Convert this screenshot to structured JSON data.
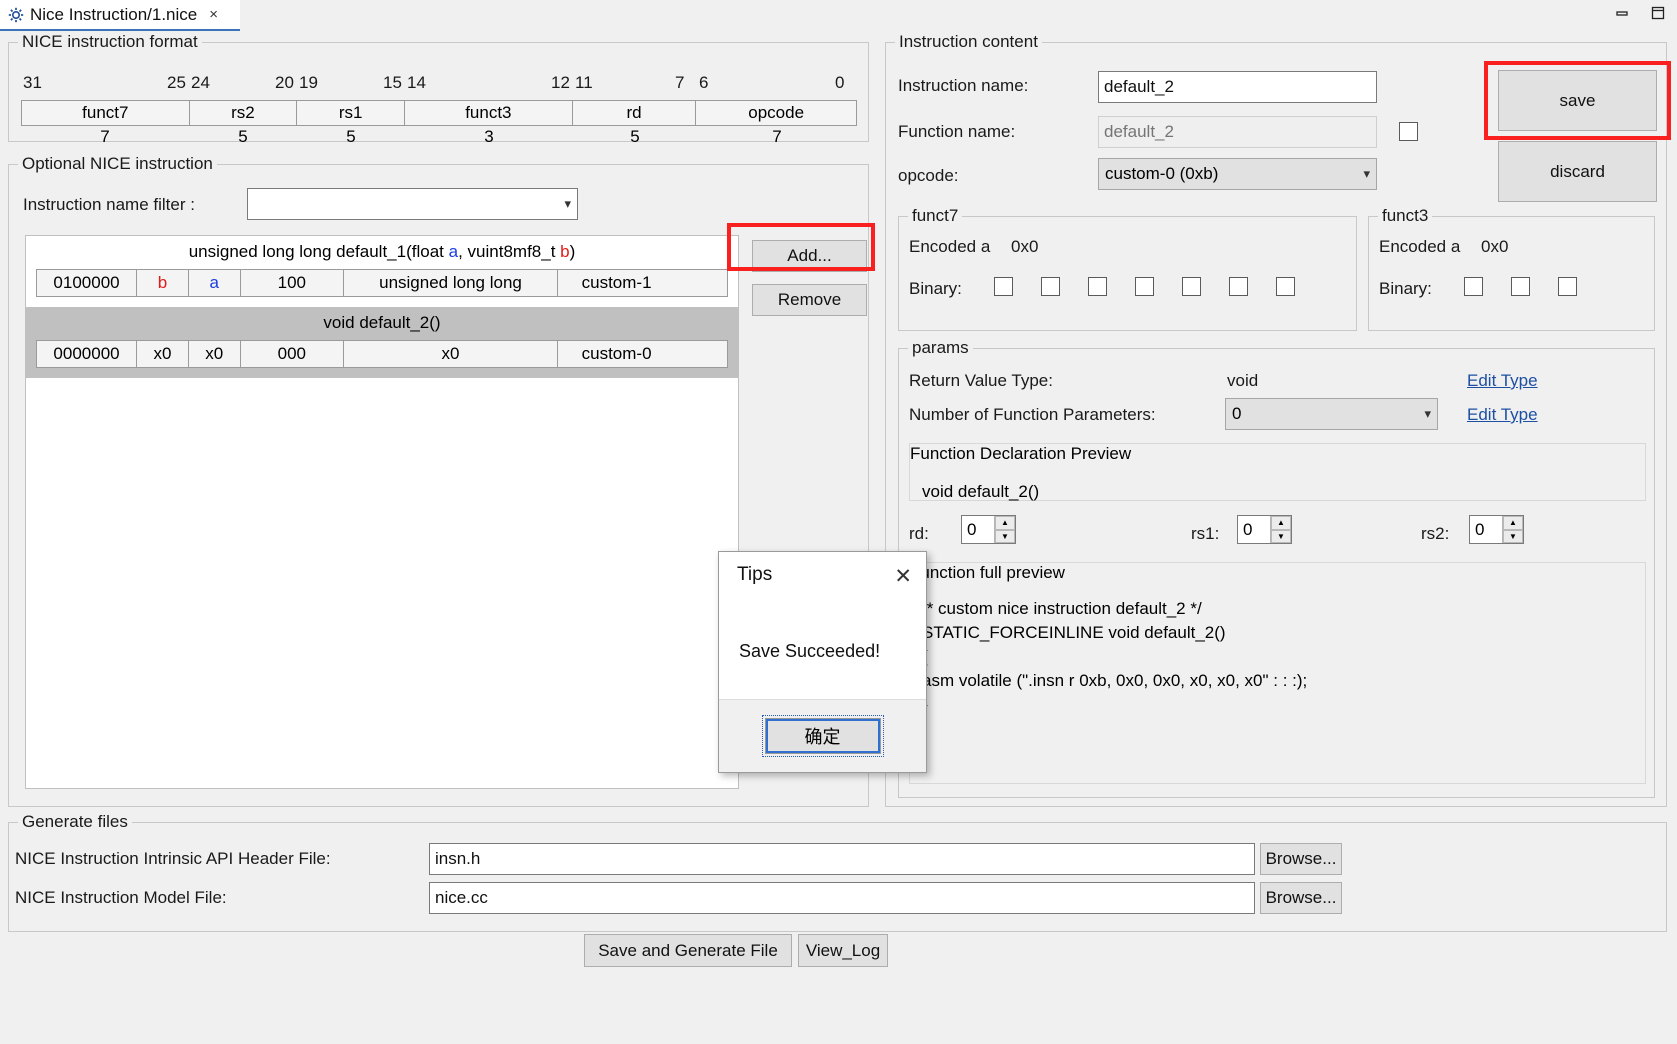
{
  "window": {
    "tab_title": "Nice Instruction/1.nice",
    "tab_close": "×",
    "tab_icon": "gear-icon",
    "minimize": "minimize-icon",
    "maximize": "maximize-icon"
  },
  "format_group": {
    "title": "NICE instruction format",
    "bit_labels": [
      "31",
      "25",
      "24",
      "20",
      "19",
      "15",
      "14",
      "12",
      "11",
      "7",
      "6",
      "0"
    ],
    "fields": [
      "funct7",
      "rs2",
      "rs1",
      "funct3",
      "rd",
      "opcode"
    ],
    "widths": [
      "7",
      "5",
      "5",
      "3",
      "5",
      "7"
    ]
  },
  "optional_group": {
    "title": "Optional NICE instruction",
    "filter_label": "Instruction name filter :",
    "filter_value": "",
    "filter_placeholder": "",
    "add_button": "Add...",
    "remove_button": "Remove",
    "instructions": [
      {
        "signature_parts": [
          {
            "text": "unsigned long long default_1(float ",
            "color": "normal"
          },
          {
            "text": "a",
            "color": "blue"
          },
          {
            "text": ", vuint8mf8_t ",
            "color": "normal"
          },
          {
            "text": "b",
            "color": "red"
          },
          {
            "text": ")",
            "color": "normal"
          }
        ],
        "cells": [
          {
            "text": "0100000",
            "color": "normal"
          },
          {
            "text": "b",
            "color": "red"
          },
          {
            "text": "a",
            "color": "blue"
          },
          {
            "text": "100",
            "color": "normal"
          },
          {
            "text": "unsigned long long",
            "color": "normal"
          },
          {
            "text": "custom-1",
            "color": "normal"
          }
        ],
        "selected": false
      },
      {
        "signature_parts": [
          {
            "text": "void default_2()",
            "color": "normal"
          }
        ],
        "cells": [
          {
            "text": "0000000",
            "color": "normal"
          },
          {
            "text": "x0",
            "color": "normal"
          },
          {
            "text": "x0",
            "color": "normal"
          },
          {
            "text": "000",
            "color": "normal"
          },
          {
            "text": "x0",
            "color": "normal"
          },
          {
            "text": "custom-0",
            "color": "normal"
          }
        ],
        "selected": true
      }
    ]
  },
  "content_group": {
    "title": "Instruction content",
    "instruction_name_label": "Instruction name:",
    "instruction_name_value": "default_2",
    "function_name_label": "Function name:",
    "function_name_value": "default_2",
    "function_name_checkbox_checked": false,
    "opcode_label": "opcode:",
    "opcode_value": "custom-0 (0xb)",
    "save_button": "save",
    "discard_button": "discard"
  },
  "funct7_group": {
    "title": "funct7",
    "encoded_label": "Encoded a",
    "encoded_value": "0x0",
    "binary_label": "Binary:",
    "bits": [
      false,
      false,
      false,
      false,
      false,
      false,
      false
    ]
  },
  "funct3_group": {
    "title": "funct3",
    "encoded_label": "Encoded a",
    "encoded_value": "0x0",
    "binary_label": "Binary:",
    "bits": [
      false,
      false,
      false
    ]
  },
  "params_group": {
    "title": "params",
    "return_type_label": "Return Value Type:",
    "return_type_value": "void",
    "return_type_edit": "Edit Type",
    "num_params_label": "Number of Function Parameters:",
    "num_params_value": "0",
    "num_params_edit": "Edit Type",
    "declaration_preview_title": "Function Declaration Preview",
    "declaration_preview_text": "void default_2()",
    "rd_label": "rd:",
    "rd_value": "0",
    "rs1_label": "rs1:",
    "rs1_value": "0",
    "rs2_label": "rs2:",
    "rs2_value": "0",
    "full_preview_title": "Function full preview",
    "full_preview_lines": [
      "/* custom nice instruction default_2 */",
      "STATIC_FORCEINLINE void default_2()",
      "{",
      "  asm volatile (\".insn r 0xb, 0x0, 0x0, x0, x0, x0\" : : :);",
      "}"
    ]
  },
  "generate_group": {
    "title": "Generate files",
    "header_label": "NICE Instruction Intrinsic API Header File:",
    "header_value": "insn.h",
    "header_browse": "Browse...",
    "model_label": "NICE Instruction Model File:",
    "model_value": "nice.cc",
    "model_browse": "Browse...",
    "save_generate_button": "Save and Generate File",
    "view_log_button": "View_Log"
  },
  "dialog": {
    "title": "Tips",
    "close": "✕",
    "message": "Save Succeeded!",
    "ok_button": "确定"
  },
  "colors": {
    "accent": "#3b74b8",
    "highlight": "#fb2020",
    "link": "#1d4fa3",
    "red_text": "#e01b1b",
    "blue_text": "#1b3de0",
    "selected_row": "#c0c0c0"
  }
}
